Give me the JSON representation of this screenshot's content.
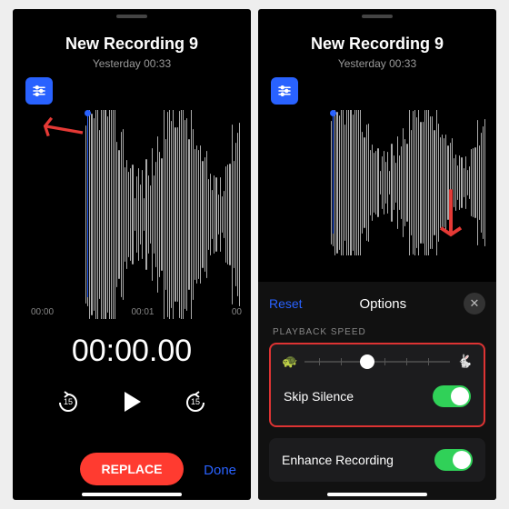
{
  "left": {
    "title": "New Recording 9",
    "subtitle": "Yesterday  00:33",
    "ticks": [
      "00:00",
      "00:01",
      "00"
    ],
    "timer": "00:00.00",
    "skip": "15",
    "replace": "REPLACE",
    "done": "Done"
  },
  "right": {
    "title": "New Recording 9",
    "subtitle": "Yesterday  00:33",
    "reset": "Reset",
    "options": "Options",
    "section": "PLAYBACK SPEED",
    "skip_silence": "Skip Silence",
    "enhance": "Enhance Recording",
    "toggles": {
      "skip_silence": true,
      "enhance": true
    }
  }
}
